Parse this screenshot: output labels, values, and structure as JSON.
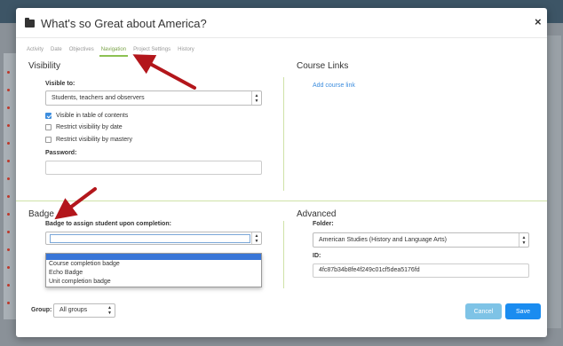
{
  "modal": {
    "title": "What's so Great about America?",
    "close": "×"
  },
  "tabs": [
    {
      "label": "Activity"
    },
    {
      "label": "Date"
    },
    {
      "label": "Objectives"
    },
    {
      "label": "Navigation",
      "active": true
    },
    {
      "label": "Project Settings"
    },
    {
      "label": "History"
    }
  ],
  "visibility": {
    "section_title": "Visibility",
    "visible_to_label": "Visible to:",
    "visible_to_value": "Students, teachers and observers",
    "options": [
      {
        "label": "Visible in table of contents",
        "checked": true
      },
      {
        "label": "Restrict visibility by date",
        "checked": false
      },
      {
        "label": "Restrict visibility by mastery",
        "checked": false
      }
    ],
    "password_label": "Password:",
    "password_value": ""
  },
  "course_links": {
    "section_title": "Course Links",
    "add_link": "Add course link"
  },
  "badge": {
    "section_title": "Badge",
    "assign_label": "Badge to assign student upon completion:",
    "selected_value": "",
    "options": [
      "",
      "Course completion badge",
      "Echo Badge",
      "Unit completion badge"
    ]
  },
  "advanced": {
    "section_title": "Advanced",
    "folder_label": "Folder:",
    "folder_value": "American Studies (History and Language Arts)",
    "id_label": "ID:",
    "id_value": "4fc87b34b8fe4f249c01cf5dea5176fd"
  },
  "footer": {
    "group_label": "Group:",
    "group_value": "All groups",
    "cancel": "Cancel",
    "save": "Save"
  },
  "colors": {
    "accent_green": "#8cc152",
    "link_blue": "#3c8dde",
    "save_blue": "#1a8cf0",
    "cancel_blue": "#7ec3e6",
    "arrow_red": "#b3161b"
  }
}
